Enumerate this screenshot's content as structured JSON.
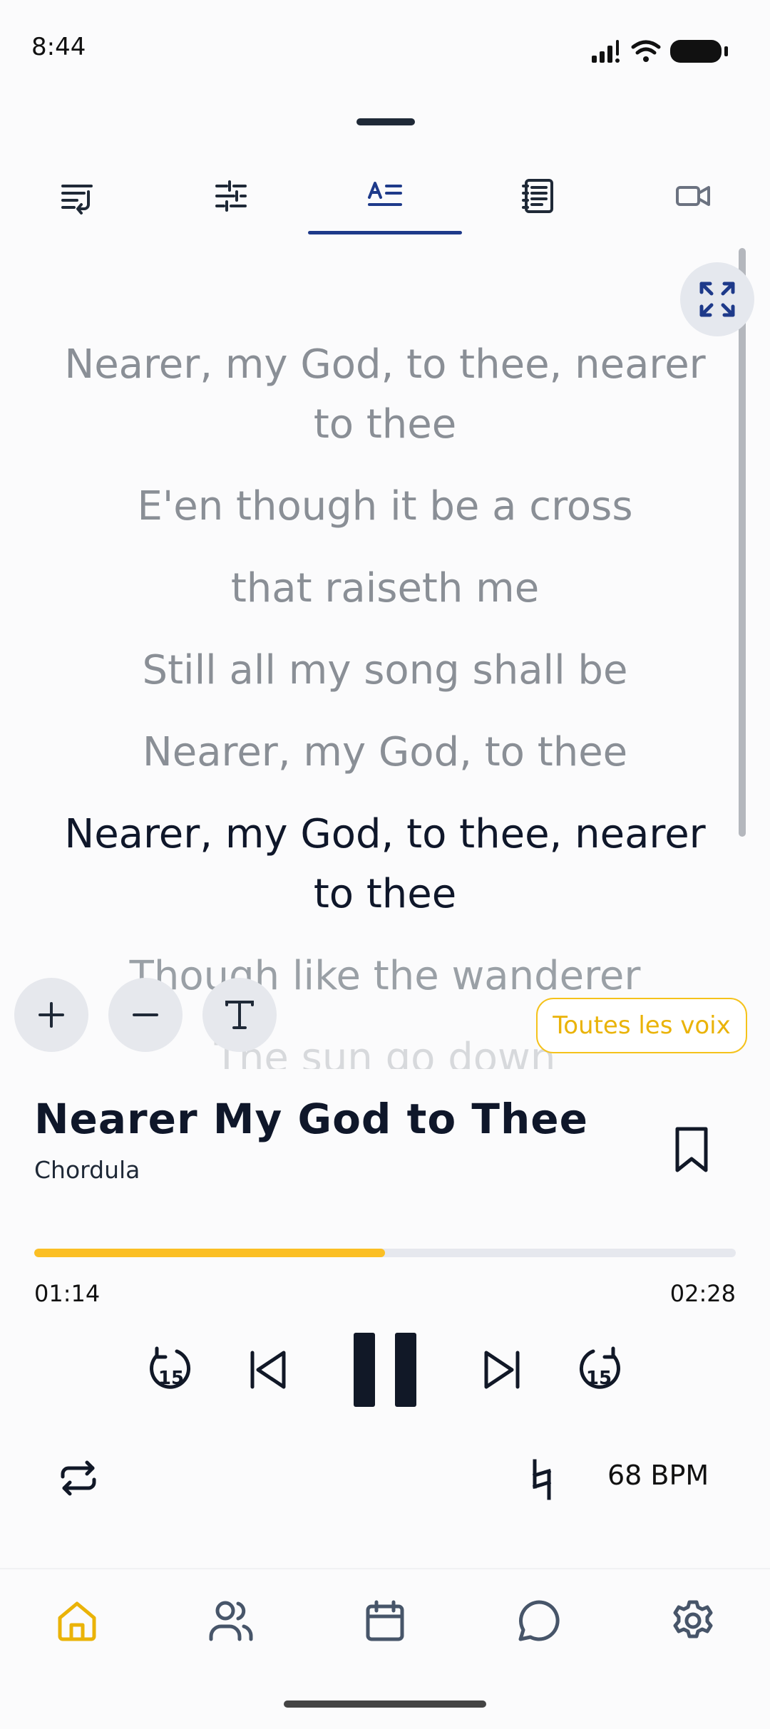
{
  "status_bar": {
    "time": "8:44"
  },
  "tabs": [
    {
      "name": "queue",
      "icon": "queue-icon"
    },
    {
      "name": "mixer",
      "icon": "sliders-icon"
    },
    {
      "name": "lyrics",
      "icon": "lyrics-icon",
      "active": true
    },
    {
      "name": "sheet",
      "icon": "sheet-icon"
    },
    {
      "name": "video",
      "icon": "video-icon"
    }
  ],
  "lyrics": {
    "lines": [
      "Nearer, my God, to thee, nearer to thee",
      "E'en though it be a cross",
      "that raiseth me",
      "Still all my song shall be",
      "Nearer, my God, to thee",
      "Nearer, my God, to thee, nearer to thee",
      "Though like the wanderer",
      "The sun go down"
    ],
    "active_index": 5
  },
  "voices_label": "Toutes les voix",
  "song": {
    "title": "Nearer My God to Thee",
    "artist": "Chordula"
  },
  "progress": {
    "current": "01:14",
    "total": "02:28",
    "fraction": 0.5
  },
  "controls": {
    "skip_back_seconds": "15",
    "skip_forward_seconds": "15"
  },
  "tempo": {
    "bpm_label": "68 BPM"
  },
  "colors": {
    "accent": "#fbbf24",
    "active_tab": "#1e3a8a",
    "nav_inactive": "#475569"
  }
}
